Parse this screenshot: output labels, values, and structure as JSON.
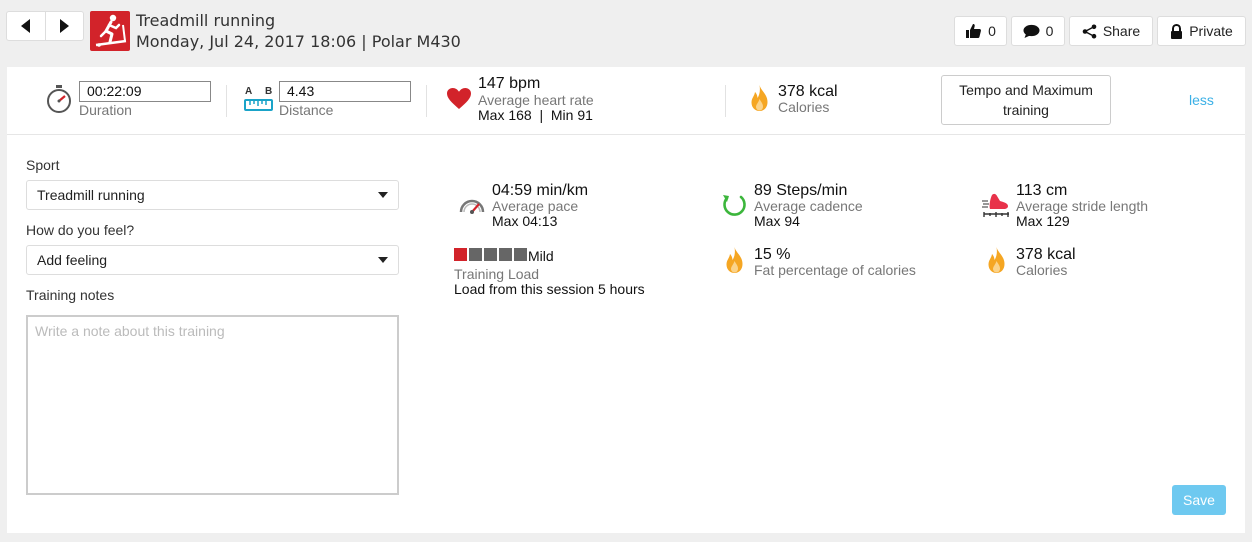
{
  "header": {
    "title": "Treadmill running",
    "subtitle": "Monday, Jul 24, 2017 18:06 | Polar M430",
    "like_count": "0",
    "comment_count": "0",
    "share_label": "Share",
    "privacy_label": "Private"
  },
  "summary": {
    "duration_value": "00:22:09",
    "duration_label": "Duration",
    "distance_value": "4.43",
    "distance_label": "Distance",
    "distance_icon_a": "A",
    "distance_icon_b": "B",
    "heart_value": "147 bpm",
    "heart_label": "Average heart rate",
    "heart_minmax": "Max 168  |  Min 91",
    "calories_value": "378 kcal",
    "calories_label": "Calories",
    "benefit_button": "Tempo and Maximum training",
    "less_link": "less"
  },
  "form": {
    "sport_label": "Sport",
    "sport_value": "Treadmill running",
    "feeling_label": "How do you feel?",
    "feeling_value": "Add feeling",
    "notes_label": "Training notes",
    "notes_placeholder": "Write a note about this training",
    "save_label": "Save"
  },
  "stats": {
    "pace_value": "04:59 min/km",
    "pace_label": "Average pace",
    "pace_max": "Max 04:13",
    "cadence_value": "89 Steps/min",
    "cadence_label": "Average cadence",
    "cadence_max": "Max 94",
    "stride_value": "113 cm",
    "stride_label": "Average stride length",
    "stride_max": "Max 129",
    "load_level": "Mild",
    "load_label": "Training Load",
    "load_detail": "Load from this session 5 hours",
    "load_filled": 1,
    "load_total": 5,
    "fat_value": "15 %",
    "fat_label": "Fat percentage of calories",
    "cal_value": "378 kcal",
    "cal_label": "Calories"
  },
  "colors": {
    "accent_red": "#d2232a",
    "link_blue": "#3bb0e6",
    "save_blue": "#6ec9f0",
    "flame_orange": "#f5a623",
    "cadence_green": "#3cb63c",
    "distance_teal": "#1aa3c8"
  },
  "icons": {
    "sport": "treadmill-runner-icon",
    "duration": "stopwatch-icon",
    "distance": "ruler-icon",
    "heart": "heart-icon",
    "calories": "flame-icon",
    "pace": "speedometer-icon",
    "cadence": "cadence-icon",
    "stride": "shoe-icon",
    "like": "thumbs-up-icon",
    "comment": "comment-icon",
    "share": "share-icon",
    "privacy": "lock-icon"
  }
}
